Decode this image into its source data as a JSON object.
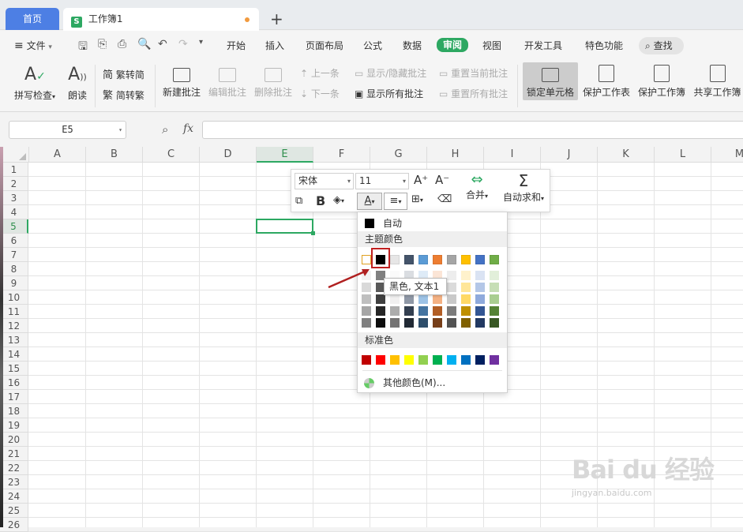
{
  "tabs": {
    "home": "首页",
    "doc": "工作簿1",
    "doc_icon": "S"
  },
  "menu": {
    "file": "文件",
    "items": [
      "开始",
      "插入",
      "页面布局",
      "公式",
      "数据",
      "审阅",
      "视图",
      "开发工具",
      "特色功能"
    ],
    "active": "审阅",
    "search": "查找"
  },
  "ribbon": {
    "spellcheck": "拼写检查",
    "read": "朗读",
    "trad_to_simp": "繁转简",
    "simp_to_trad": "简转繁",
    "new_comment": "新建批注",
    "edit_comment": "编辑批注",
    "delete_comment": "删除批注",
    "prev": "上一条",
    "next": "下一条",
    "show_hide_comment": "显示/隐藏批注",
    "show_all_comments": "显示所有批注",
    "reset_current_comment": "重置当前批注",
    "reset_all_comments": "重置所有批注",
    "lock_cell": "锁定单元格",
    "protect_sheet": "保护工作表",
    "protect_book": "保护工作簿",
    "share_book": "共享工作簿"
  },
  "formula": {
    "name_box": "E5",
    "fx": "fx"
  },
  "grid": {
    "columns": [
      "A",
      "B",
      "C",
      "D",
      "E",
      "F",
      "G",
      "H",
      "I",
      "J",
      "K",
      "L",
      "M"
    ],
    "rows": [
      "1",
      "2",
      "3",
      "4",
      "5",
      "6",
      "7",
      "8",
      "9",
      "10",
      "11",
      "12",
      "13",
      "14",
      "15",
      "16",
      "17",
      "18",
      "19",
      "20",
      "21",
      "22",
      "23",
      "24",
      "25",
      "26"
    ],
    "active_col": "E",
    "active_row": "5"
  },
  "mini_toolbar": {
    "font": "宋体",
    "size": "11",
    "merge": "合并",
    "autosum": "自动求和",
    "bold": "B"
  },
  "palette": {
    "auto": "自动",
    "theme_title": "主题颜色",
    "standard_title": "标准色",
    "more": "其他颜色(M)...",
    "tooltip": "黑色, 文本1",
    "theme_colors": [
      "#ffffff",
      "#000000",
      "#e7e6e6",
      "#44546a",
      "#5b9bd5",
      "#ed7d31",
      "#a5a5a5",
      "#ffc000",
      "#4472c4",
      "#70ad47"
    ],
    "standard_colors": [
      "#c00000",
      "#ff0000",
      "#ffc000",
      "#ffff00",
      "#92d050",
      "#00b050",
      "#00b0f0",
      "#0070c0",
      "#002060",
      "#7030a0"
    ]
  },
  "watermark": {
    "brand": "Bai du 经验",
    "url": "jingyan.baidu.com"
  }
}
